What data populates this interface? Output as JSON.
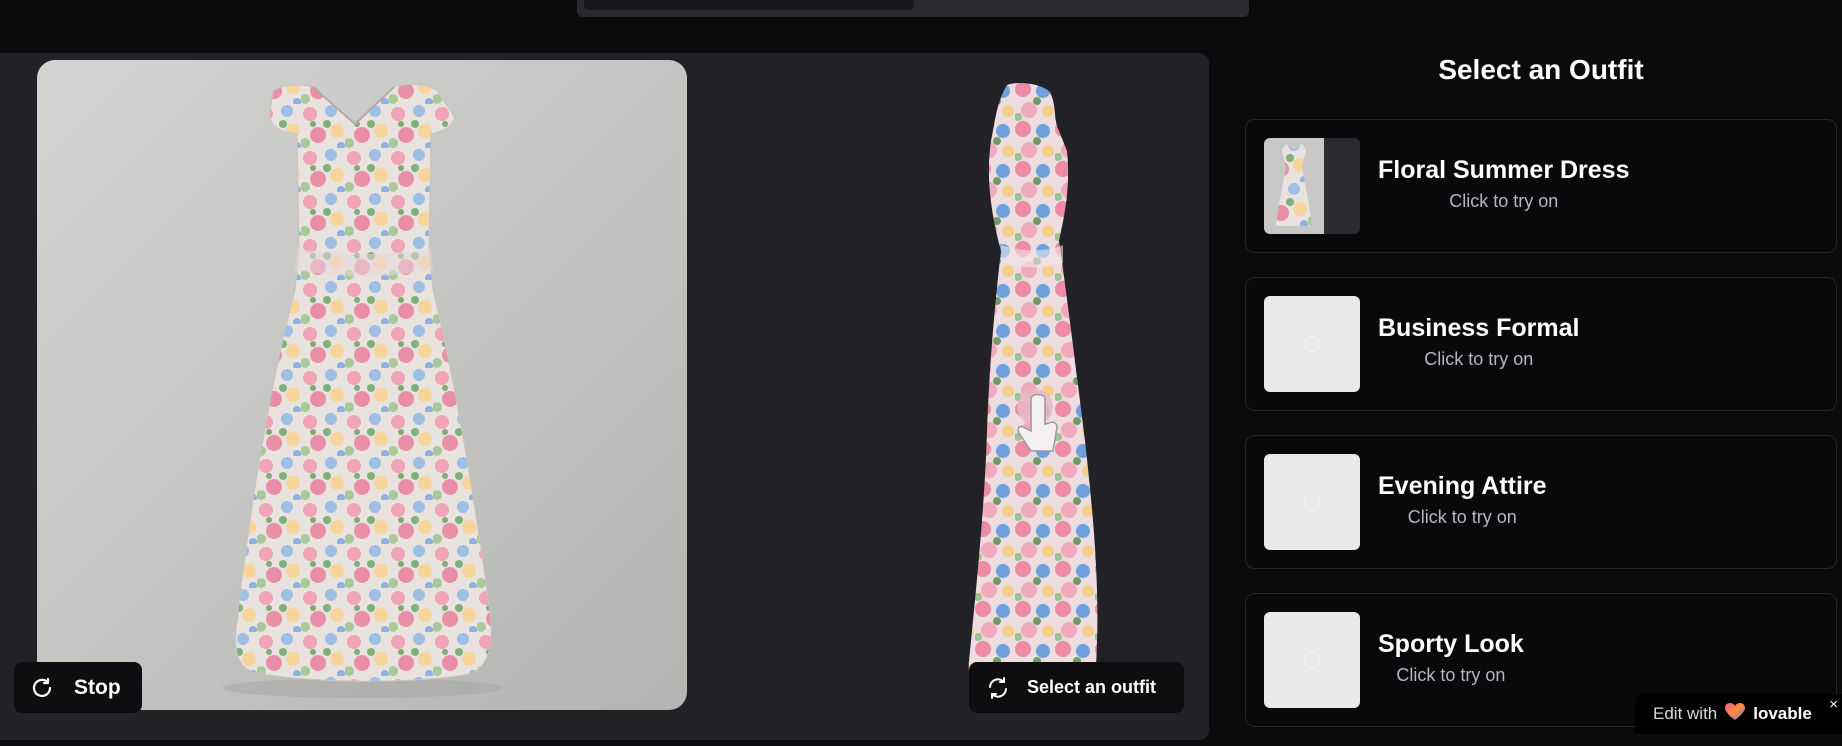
{
  "stage": {
    "stop_label": "Stop",
    "select_label": "Select an outfit"
  },
  "panel": {
    "title": "Select an Outfit",
    "outfits": [
      {
        "name": "Floral Summer Dress",
        "subtitle": "Click to try on"
      },
      {
        "name": "Business Formal",
        "subtitle": "Click to try on"
      },
      {
        "name": "Evening Attire",
        "subtitle": "Click to try on"
      },
      {
        "name": "Sporty Look",
        "subtitle": "Click to try on"
      }
    ]
  },
  "badge": {
    "edit_label": "Edit with",
    "brand": "lovable",
    "close": "×"
  },
  "icons": {
    "stop": "refresh-icon",
    "select": "swap-icon",
    "heart": "heart-icon",
    "cursor": "hand-pointer-icon"
  },
  "colors": {
    "background": "#0b0b0d",
    "stage": "#222226",
    "card_border": "#26262b",
    "subtitle": "#b6b6bc"
  }
}
